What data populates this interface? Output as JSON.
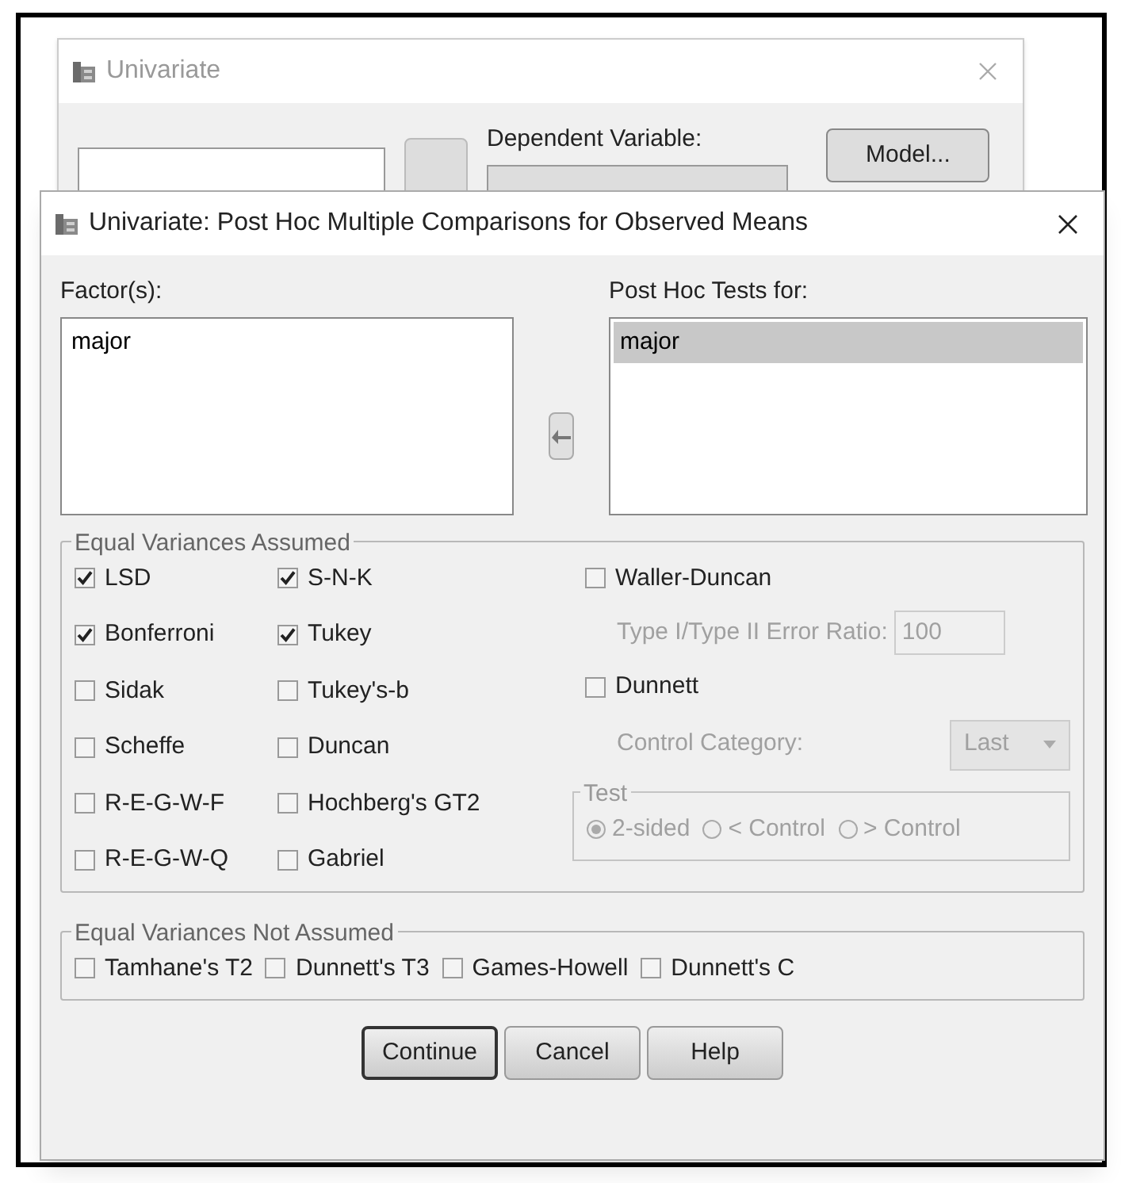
{
  "background_window": {
    "title": "Univariate",
    "dependent_label": "Dependent Variable:",
    "model_button": "Model..."
  },
  "dialog": {
    "title": "Univariate: Post Hoc Multiple Comparisons for Observed Means",
    "factors": {
      "label": "Factor(s):",
      "items": [
        {
          "name": "major",
          "selected": false
        }
      ]
    },
    "tests_for": {
      "label": "Post Hoc Tests for:",
      "items": [
        {
          "name": "major",
          "selected": true
        }
      ]
    },
    "equal_assumed": {
      "title": "Equal Variances Assumed",
      "column_1": [
        {
          "label": "LSD",
          "checked": true
        },
        {
          "label": "Bonferroni",
          "checked": true
        },
        {
          "label": "Sidak",
          "checked": false
        },
        {
          "label": "Scheffe",
          "checked": false
        },
        {
          "label": "R-E-G-W-F",
          "checked": false
        },
        {
          "label": "R-E-G-W-Q",
          "checked": false
        }
      ],
      "column_2": [
        {
          "label": "S-N-K",
          "checked": true
        },
        {
          "label": "Tukey",
          "checked": true
        },
        {
          "label": "Tukey's-b",
          "checked": false
        },
        {
          "label": "Duncan",
          "checked": false
        },
        {
          "label": "Hochberg's GT2",
          "checked": false
        },
        {
          "label": "Gabriel",
          "checked": false
        }
      ],
      "waller": {
        "label": "Waller-Duncan",
        "checked": false
      },
      "ratio": {
        "label": "Type I/Type II Error Ratio:",
        "value": "100",
        "disabled": true
      },
      "dunnett": {
        "label": "Dunnett",
        "checked": false
      },
      "control_category": {
        "label": "Control Category:",
        "value": "Last",
        "disabled": true
      },
      "test": {
        "title": "Test",
        "disabled": true,
        "options": [
          {
            "label": "2-sided",
            "selected": true
          },
          {
            "label": "< Control",
            "selected": false
          },
          {
            "label": "> Control",
            "selected": false
          }
        ]
      }
    },
    "not_assumed": {
      "title": "Equal Variances Not Assumed",
      "tests": [
        {
          "label": "Tamhane's T2",
          "checked": false
        },
        {
          "label": "Dunnett's T3",
          "checked": false
        },
        {
          "label": "Games-Howell",
          "checked": false
        },
        {
          "label": "Dunnett's C",
          "checked": false
        }
      ]
    },
    "buttons": [
      {
        "label": "Continue",
        "default": true
      },
      {
        "label": "Cancel",
        "default": false
      },
      {
        "label": "Help",
        "default": false
      }
    ]
  }
}
